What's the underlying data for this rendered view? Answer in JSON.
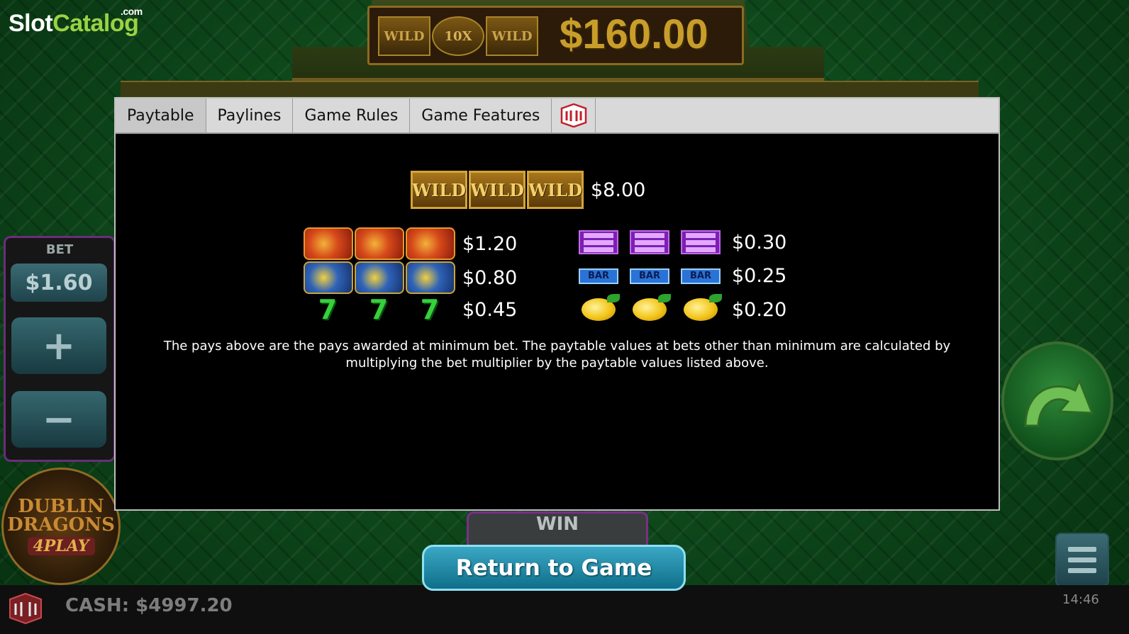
{
  "brand": {
    "slot": "Slot",
    "catalog": "Catalog",
    "com": ".com"
  },
  "jackpot": {
    "wild": "WILD",
    "multiplier": "10X",
    "amount": "$160.00"
  },
  "bet": {
    "label": "BET",
    "value": "$1.60",
    "plus": "+",
    "minus": "−"
  },
  "game_logo": {
    "line1": "DUBLIN",
    "line2": "DRAGONS",
    "line3": "4PLAY"
  },
  "win": {
    "label": "WIN"
  },
  "tabs": [
    {
      "label": "Paytable",
      "active": true
    },
    {
      "label": "Paylines"
    },
    {
      "label": "Game Rules"
    },
    {
      "label": "Game Features"
    }
  ],
  "tab_icon": "dwg-logo-icon",
  "paytable": {
    "top": {
      "symbol": "wild",
      "symbol_text": "WILD",
      "amount": "$8.00"
    },
    "left": [
      {
        "symbol": "red-dragon",
        "amount": "$1.20"
      },
      {
        "symbol": "blue-dragon",
        "amount": "$0.80"
      },
      {
        "symbol": "seven",
        "symbol_text": "7",
        "amount": "$0.45"
      }
    ],
    "right": [
      {
        "symbol": "triple-bar",
        "amount": "$0.30"
      },
      {
        "symbol": "bar",
        "symbol_text": "BAR",
        "amount": "$0.25"
      },
      {
        "symbol": "lemon",
        "amount": "$0.20"
      }
    ],
    "note": "The pays above are the pays awarded at minimum bet. The paytable values at bets other than minimum are calculated by multiplying the bet multiplier by the paytable values listed above."
  },
  "return_button": "Return to Game",
  "cash": "CASH: $4997.20",
  "clock": "14:46",
  "colors": {
    "accent_green": "#9bd245",
    "panel_purple": "#6b2d7d",
    "button_blue": "#3aa7c4",
    "gold": "#c99d2a"
  }
}
